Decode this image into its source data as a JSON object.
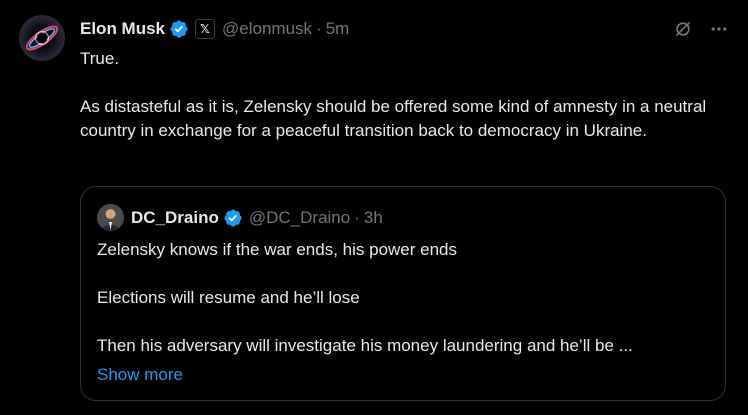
{
  "tweet": {
    "author_name": "Elon Musk",
    "affiliation_badge": "𝕏",
    "handle": "@elonmusk",
    "separator": "·",
    "time": "5m",
    "paragraphs": [
      "True.",
      "As distasteful as it is, Zelensky should be offered some kind of amnesty in a neutral country in exchange for a peaceful transition back to democracy in Ukraine."
    ]
  },
  "quote": {
    "author_name": "DC_Draino",
    "handle": "@DC_Draino",
    "separator": "·",
    "time": "3h",
    "paragraphs": [
      "Zelensky knows if the war ends, his power ends",
      "Elections will resume and he’ll lose",
      "Then his adversary will investigate his money laundering and he’ll be ..."
    ],
    "show_more_label": "Show more"
  },
  "icons": {
    "verified": "verified-badge-icon",
    "grok": "grok-icon",
    "more": "more-icon"
  },
  "colors": {
    "background": "#000000",
    "text": "#e7e9ea",
    "secondary": "#71767b",
    "accent": "#1d9bf0",
    "border": "#2f3336"
  }
}
